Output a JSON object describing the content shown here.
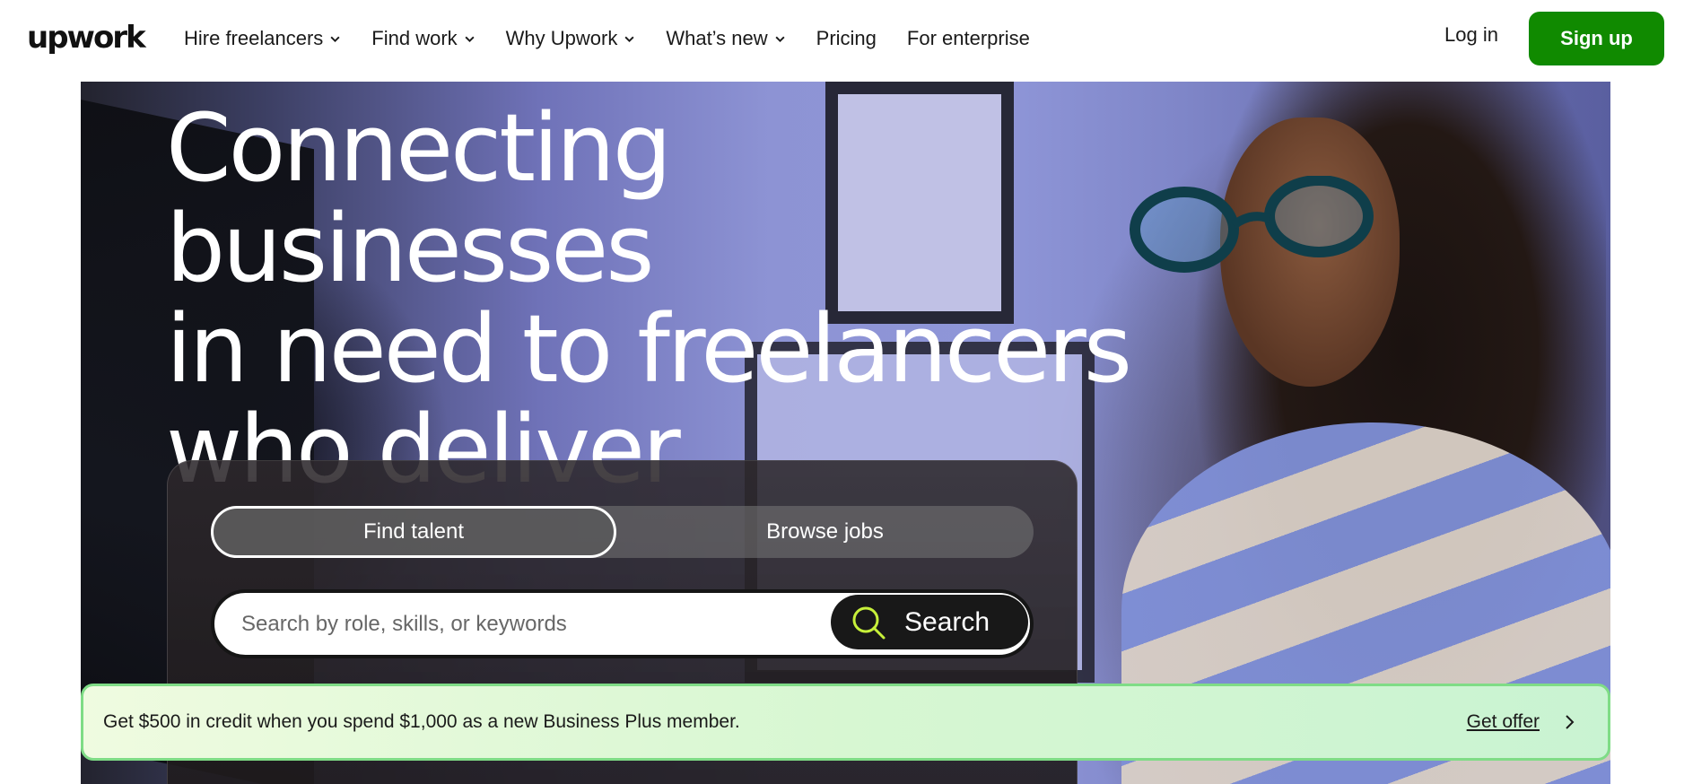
{
  "header": {
    "logo": "upwork",
    "nav": [
      {
        "label": "Hire freelancers",
        "dropdown": true
      },
      {
        "label": "Find work",
        "dropdown": true
      },
      {
        "label": "Why Upwork",
        "dropdown": true
      },
      {
        "label": "What’s new",
        "dropdown": true
      },
      {
        "label": "Pricing",
        "dropdown": false
      },
      {
        "label": "For enterprise",
        "dropdown": false
      }
    ],
    "login_label": "Log in",
    "signup_label": "Sign up"
  },
  "hero": {
    "headline_lines": [
      "Connecting businesses",
      "in need to freelancers",
      "who deliver"
    ],
    "tabs": {
      "active": "Find talent",
      "other": "Browse jobs"
    },
    "search": {
      "placeholder": "Search by role, skills, or keywords",
      "button_label": "Search"
    }
  },
  "promo": {
    "text": "Get $500 in credit when you spend $1,000 as a new Business Plus member.",
    "link_label": "Get offer"
  },
  "colors": {
    "brand_green": "#108a00",
    "search_accent": "#c7f03a",
    "promo_border": "#7fdc86"
  }
}
